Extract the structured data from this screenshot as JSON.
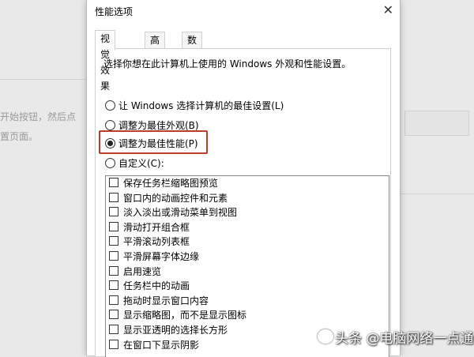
{
  "background": {
    "text1": "开始按钮，然后点",
    "text2": "置页面。"
  },
  "dialog": {
    "title": "性能选项",
    "close_glyph": "✕",
    "tabs": [
      {
        "label": "视觉效果",
        "active": true
      },
      {
        "label": "高级",
        "active": false
      },
      {
        "label": "数据执行保护",
        "active": false
      }
    ],
    "description": "选择你想在此计算机上使用的 Windows 外观和性能设置。",
    "options": [
      {
        "label": "让 Windows 选择计算机的最佳设置(L)",
        "checked": false
      },
      {
        "label": "调整为最佳外观(B)",
        "checked": false
      },
      {
        "label": "调整为最佳性能(P)",
        "checked": true
      },
      {
        "label": "自定义(C):",
        "checked": false
      }
    ],
    "effects": [
      "保存任务栏缩略图预览",
      "窗口内的动画控件和元素",
      "淡入淡出或滑动菜单到视图",
      "滑动打开组合框",
      "平滑滚动列表框",
      "平滑屏幕字体边缘",
      "启用速览",
      "任务栏中的动画",
      "拖动时显示窗口内容",
      "显示缩略图，而不是显示图标",
      "显示亚透明的选择长方形",
      "在窗口下显示阴影"
    ]
  },
  "watermark": {
    "text": "头条 @电脑网络一点通"
  },
  "colors": {
    "highlight": "#c0392b"
  }
}
